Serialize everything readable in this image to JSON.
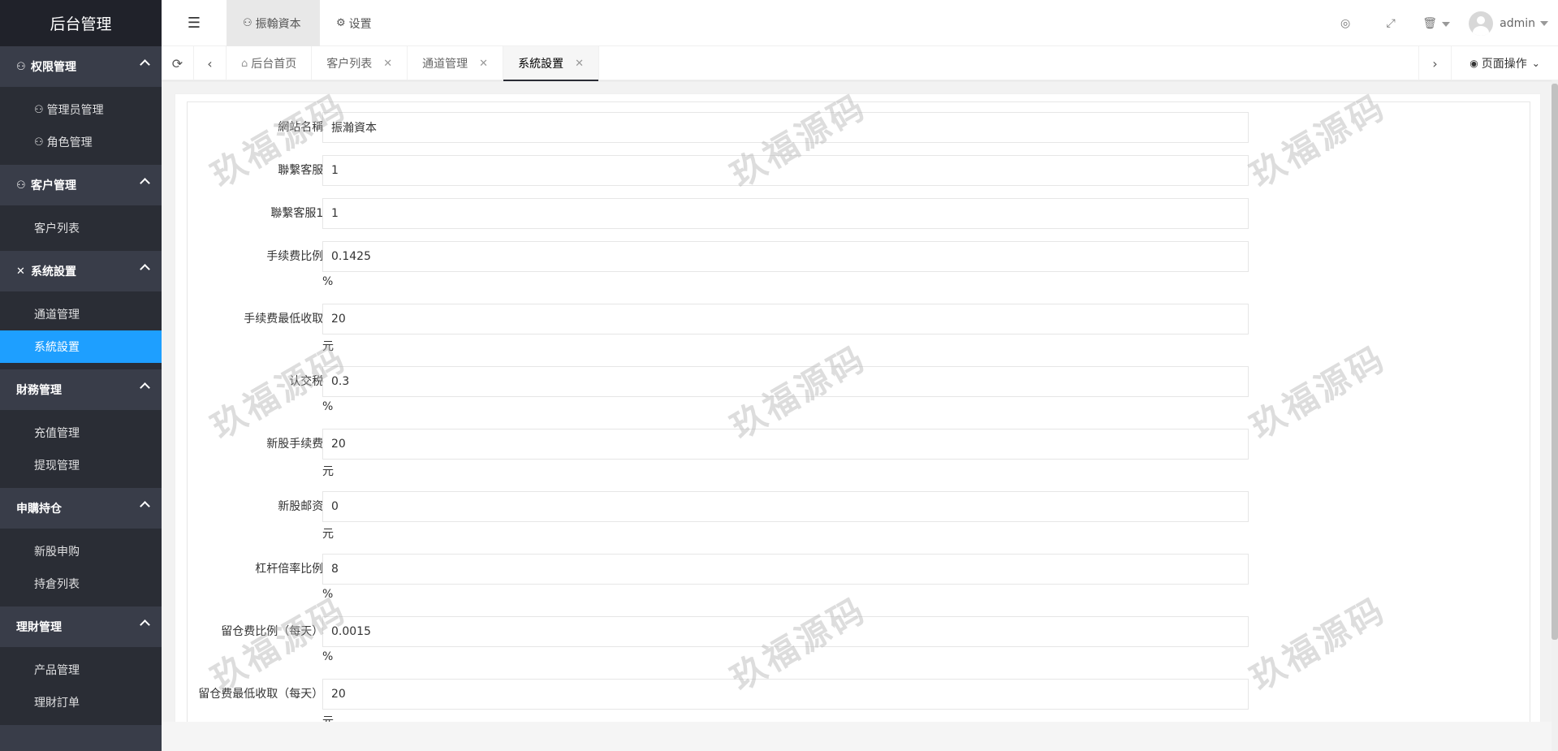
{
  "sidebar": {
    "logo": "后台管理",
    "groups": [
      {
        "title": "权限管理",
        "icon": "user-icon",
        "items": [
          {
            "label": "管理员管理",
            "icon": "user-icon"
          },
          {
            "label": "角色管理",
            "icon": "user-icon"
          }
        ]
      },
      {
        "title": "客户管理",
        "icon": "user-icon",
        "items": [
          {
            "label": "客户列表"
          }
        ]
      },
      {
        "title": "系统設置",
        "icon": "tools-icon",
        "items": [
          {
            "label": "通道管理"
          },
          {
            "label": "系統設置",
            "active": true
          }
        ]
      },
      {
        "title": "財務管理",
        "items": [
          {
            "label": "充值管理"
          },
          {
            "label": "提现管理"
          }
        ]
      },
      {
        "title": "申購持仓",
        "items": [
          {
            "label": "新股申购"
          },
          {
            "label": "持倉列表"
          }
        ]
      },
      {
        "title": "理財管理",
        "items": [
          {
            "label": "产品管理"
          },
          {
            "label": "理財訂单"
          }
        ]
      }
    ]
  },
  "header": {
    "menu_icon": "☰",
    "tabs": [
      {
        "label": "振翰資本",
        "icon": "user-icon"
      },
      {
        "label": "设置",
        "icon": "gear-icon"
      }
    ],
    "user": "admin"
  },
  "tabbar": {
    "tabs": [
      {
        "label": "后台首页",
        "icon": "home-icon",
        "closable": false
      },
      {
        "label": "客户列表",
        "closable": true
      },
      {
        "label": "通道管理",
        "closable": true
      },
      {
        "label": "系統設置",
        "closable": true,
        "active": true
      }
    ],
    "page_ops": "页面操作"
  },
  "form": {
    "fields": [
      {
        "label": "網站名稱:",
        "value": "振瀚資本",
        "unit": ""
      },
      {
        "label": "聯繫客服:",
        "value": "1",
        "unit": ""
      },
      {
        "label": "聯繫客服1:",
        "value": "1",
        "unit": ""
      },
      {
        "label": "手续费比例:",
        "value": "0.1425",
        "unit": "%"
      },
      {
        "label": "手续费最低收取:",
        "value": "20",
        "unit": "元"
      },
      {
        "label": "认交税:",
        "value": "0.3",
        "unit": "%"
      },
      {
        "label": "新股手续费:",
        "value": "20",
        "unit": "元"
      },
      {
        "label": "新股邮资:",
        "value": "0",
        "unit": "元"
      },
      {
        "label": "杠杆倍率比例:",
        "value": "8",
        "unit": "%"
      },
      {
        "label": "留仓费比例（每天）:",
        "value": "0.0015",
        "unit": "%"
      },
      {
        "label": "留仓费最低收取（每天）:",
        "value": "20",
        "unit": "元"
      }
    ]
  },
  "watermark": "玖福源码",
  "colors": {
    "sidebar_bg": "#393d49",
    "sidebar_sub_bg": "#2a2d35",
    "logo_bg": "#20222a",
    "accent": "#1e9fff"
  }
}
